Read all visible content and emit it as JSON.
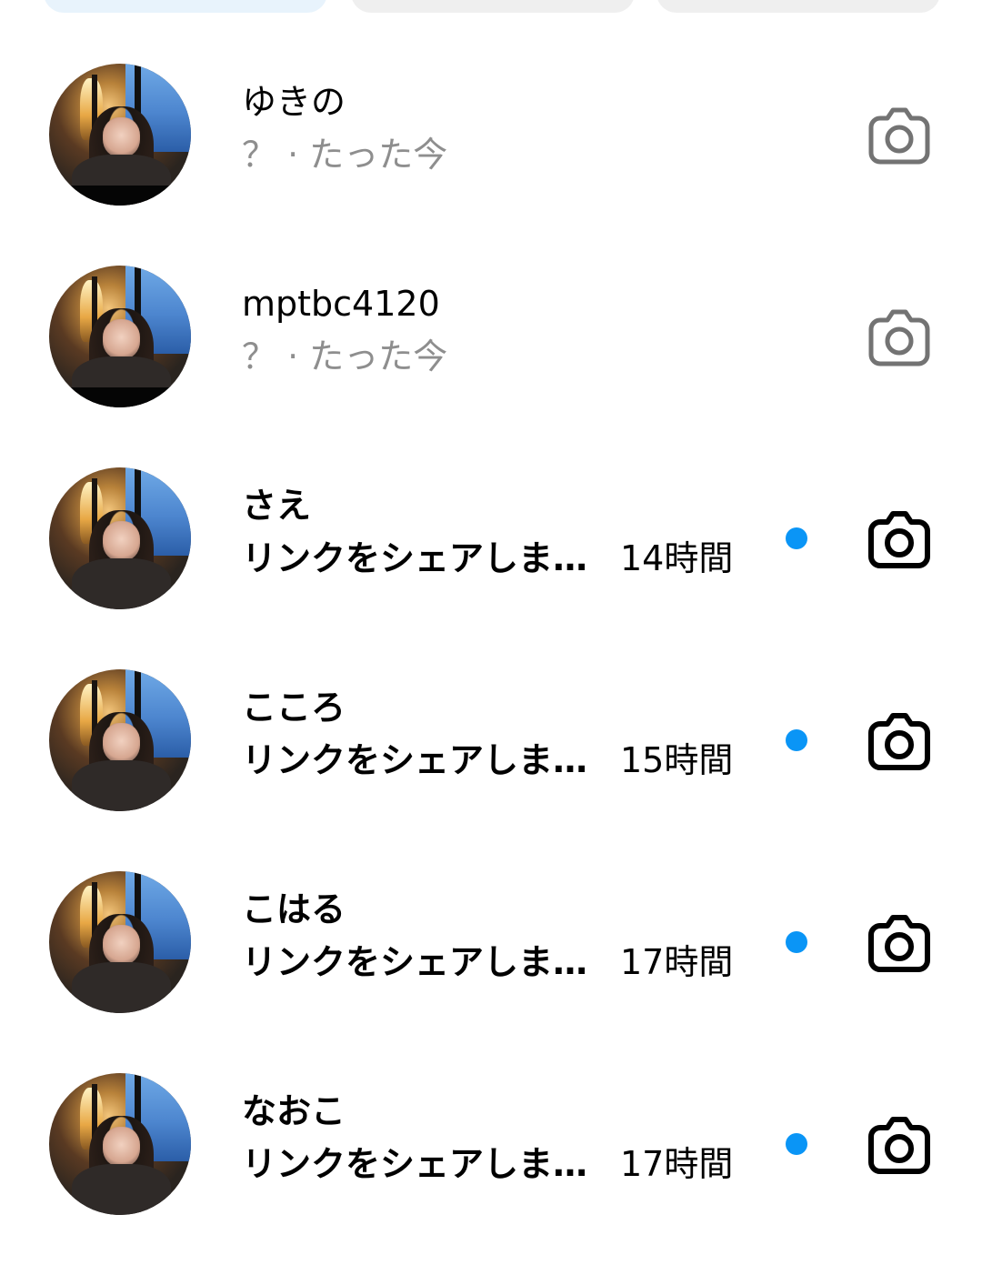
{
  "tabs": [
    {
      "name": "tab-primary"
    },
    {
      "name": "tab-general"
    },
    {
      "name": "tab-requests"
    }
  ],
  "colors": {
    "unread_dot": "#0a95f6",
    "muted_text": "#8e8e8e",
    "active_tab_bg": "#e8f3fc",
    "tab_bg": "#efefef"
  },
  "threads": [
    {
      "name": "ゆきの",
      "preview": "？ · たった今",
      "time": "",
      "unread": false,
      "icon": "camera-icon"
    },
    {
      "name": "mptbc4120",
      "preview": "？ · たった今",
      "time": "",
      "unread": false,
      "icon": "camera-icon"
    },
    {
      "name": "さえ",
      "preview": "リンクをシェアしま…",
      "time": "14時間",
      "unread": true,
      "icon": "camera-icon"
    },
    {
      "name": "こころ",
      "preview": "リンクをシェアしま…",
      "time": "15時間",
      "unread": true,
      "icon": "camera-icon"
    },
    {
      "name": "こはる",
      "preview": "リンクをシェアしま…",
      "time": "17時間",
      "unread": true,
      "icon": "camera-icon"
    },
    {
      "name": "なおこ",
      "preview": "リンクをシェアしま…",
      "time": "17時間",
      "unread": true,
      "icon": "camera-icon"
    }
  ]
}
